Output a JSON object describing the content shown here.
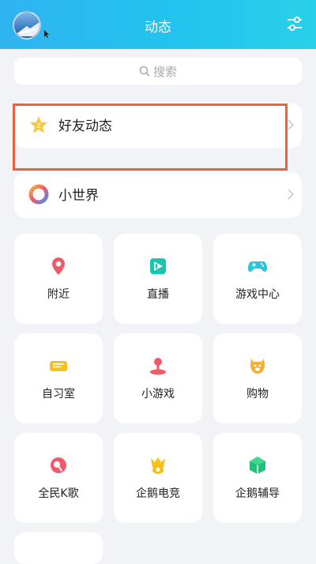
{
  "header": {
    "title": "动态"
  },
  "search": {
    "placeholder": "搜索"
  },
  "rows": [
    {
      "label": "好友动态",
      "icon": "star-badge-icon"
    },
    {
      "label": "小世界",
      "icon": "ring-icon"
    }
  ],
  "grid": [
    {
      "label": "附近",
      "icon": "location-pin-icon",
      "color": "#ef5a6a"
    },
    {
      "label": "直播",
      "icon": "live-icon",
      "color": "#18c5b0"
    },
    {
      "label": "游戏中心",
      "icon": "gamepad-icon",
      "color": "#28c6d8"
    },
    {
      "label": "自习室",
      "icon": "study-room-icon",
      "color": "#f5c21b"
    },
    {
      "label": "小游戏",
      "icon": "joystick-icon",
      "color": "#ef5a6a"
    },
    {
      "label": "购物",
      "icon": "shopping-icon",
      "color": "#f2b23a"
    },
    {
      "label": "全民K歌",
      "icon": "karaoke-icon",
      "color": "#ef5a6a"
    },
    {
      "label": "企鹅电竞",
      "icon": "esports-icon",
      "color": "#f5c21b"
    },
    {
      "label": "企鹅辅导",
      "icon": "tutoring-icon",
      "color": "#21c07a"
    }
  ]
}
